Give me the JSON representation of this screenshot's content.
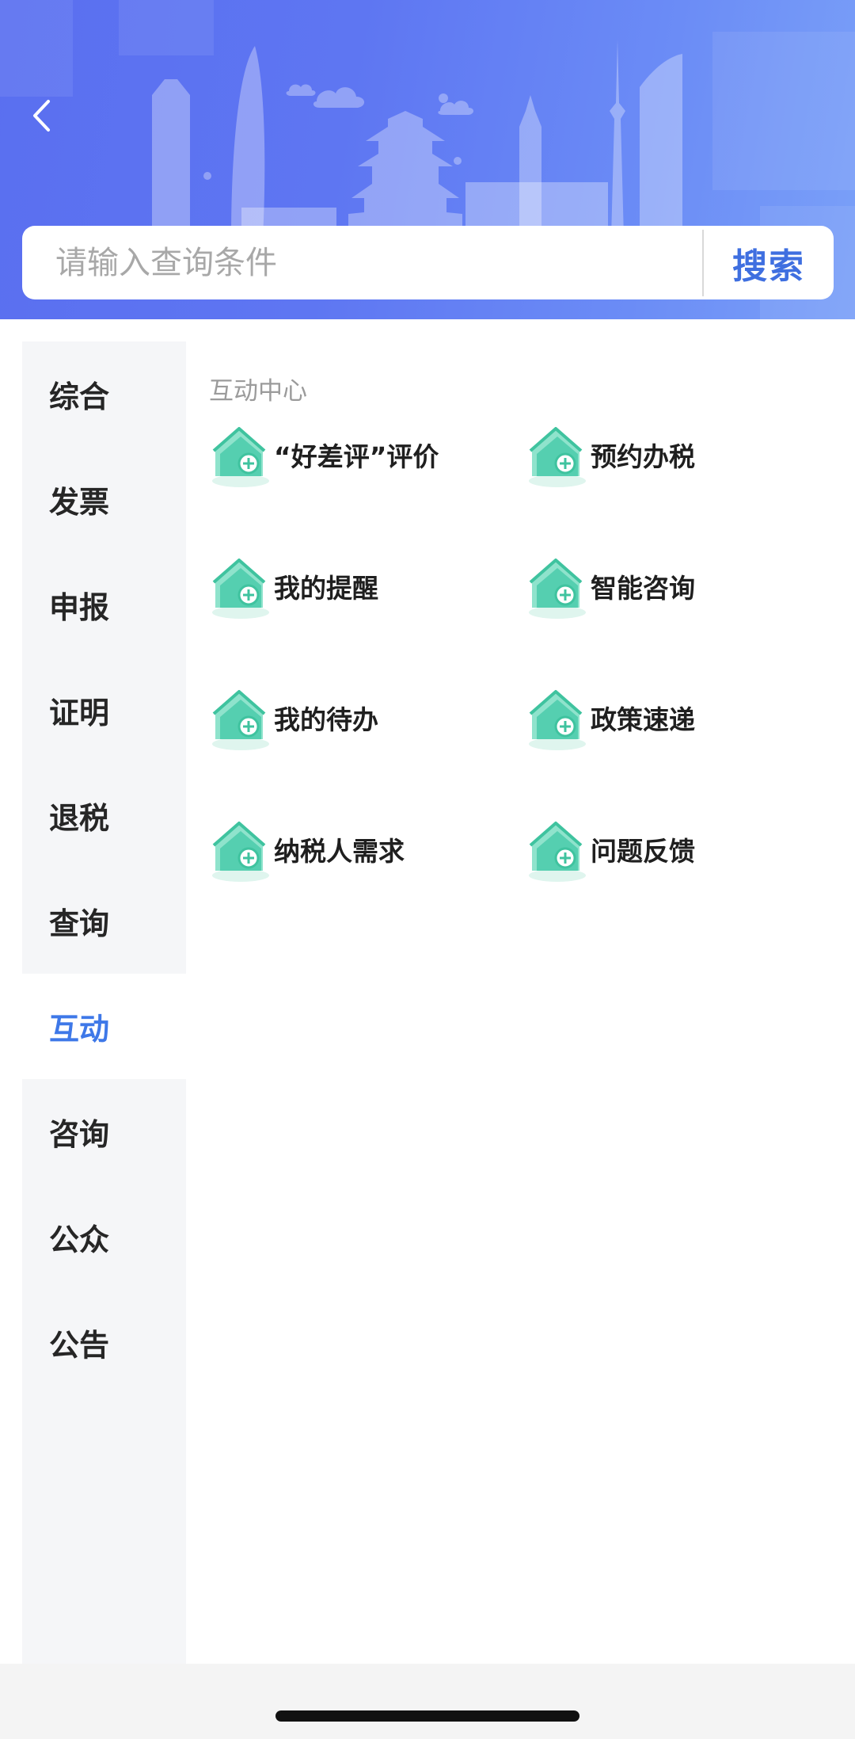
{
  "header": {
    "back_icon": "chevron-left-icon"
  },
  "search": {
    "placeholder": "请输入查询条件",
    "button_label": "搜索",
    "accent_color": "#3f6fe0"
  },
  "sidebar": {
    "active_color": "#3e78e8",
    "items": [
      {
        "label": "综合",
        "active": false
      },
      {
        "label": "发票",
        "active": false
      },
      {
        "label": "申报",
        "active": false
      },
      {
        "label": "证明",
        "active": false
      },
      {
        "label": "退税",
        "active": false
      },
      {
        "label": "查询",
        "active": false
      },
      {
        "label": "互动",
        "active": true
      },
      {
        "label": "咨询",
        "active": false
      },
      {
        "label": "公众",
        "active": false
      },
      {
        "label": "公告",
        "active": false
      }
    ]
  },
  "content": {
    "section_title": "互动中心",
    "item_icon": "house-plus-icon",
    "items": [
      {
        "label": "“好差评”评价"
      },
      {
        "label": "预约办税"
      },
      {
        "label": "我的提醒"
      },
      {
        "label": "智能咨询"
      },
      {
        "label": "我的待办"
      },
      {
        "label": "政策速递"
      },
      {
        "label": "纳税人需求"
      },
      {
        "label": "问题反馈"
      }
    ]
  }
}
